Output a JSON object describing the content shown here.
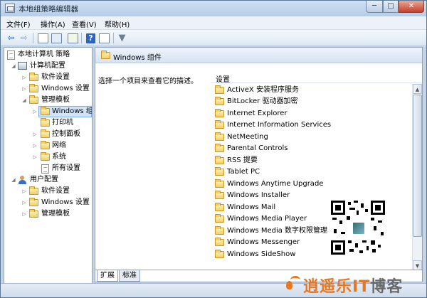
{
  "window": {
    "title": "本地组策略编辑器",
    "controls": {
      "minimize": "─",
      "maximize": "□",
      "close": "✕"
    }
  },
  "menu": [
    "文件(F)",
    "操作(A)",
    "查看(V)",
    "帮助(H)"
  ],
  "toolbar": {
    "back_glyph": "⇦",
    "forward_glyph": "⇨",
    "help_glyph": "?",
    "filter_glyph": "▼"
  },
  "tree": {
    "root": "本地计算机 策略",
    "computer_config": "计算机配置",
    "computer_children": [
      "软件设置",
      "Windows 设置",
      "管理模板"
    ],
    "admin_templates_children": [
      "Windows 组件",
      "打印机",
      "控制面板",
      "网络",
      "系统",
      "所有设置"
    ],
    "user_config": "用户配置",
    "user_children": [
      "软件设置",
      "Windows 设置",
      "管理模板"
    ]
  },
  "main": {
    "header_title": "Windows 组件",
    "description": "选择一个项目来查看它的描述。",
    "column_header": "设置",
    "items": [
      "ActiveX 安装程序服务",
      "BitLocker 驱动器加密",
      "Internet Explorer",
      "Internet Information Services",
      "NetMeeting",
      "Parental Controls",
      "RSS 提要",
      "Tablet PC",
      "Windows Anytime Upgrade",
      "Windows Installer",
      "Windows Mail",
      "Windows Media Player",
      "Windows Media 数字权限管理",
      "Windows Messenger",
      "Windows SideShow"
    ]
  },
  "tabs": [
    "扩展",
    "标准"
  ],
  "scrollbar": {
    "up_glyph": "▲",
    "down_glyph": "▼"
  },
  "brand": {
    "name_part1": "逍遥乐",
    "name_part2": "IT",
    "name_part3": "博客"
  },
  "colors": {
    "accent": "#e87722",
    "brand_gray": "#6a6a6a",
    "selection": "#cde4fa"
  }
}
